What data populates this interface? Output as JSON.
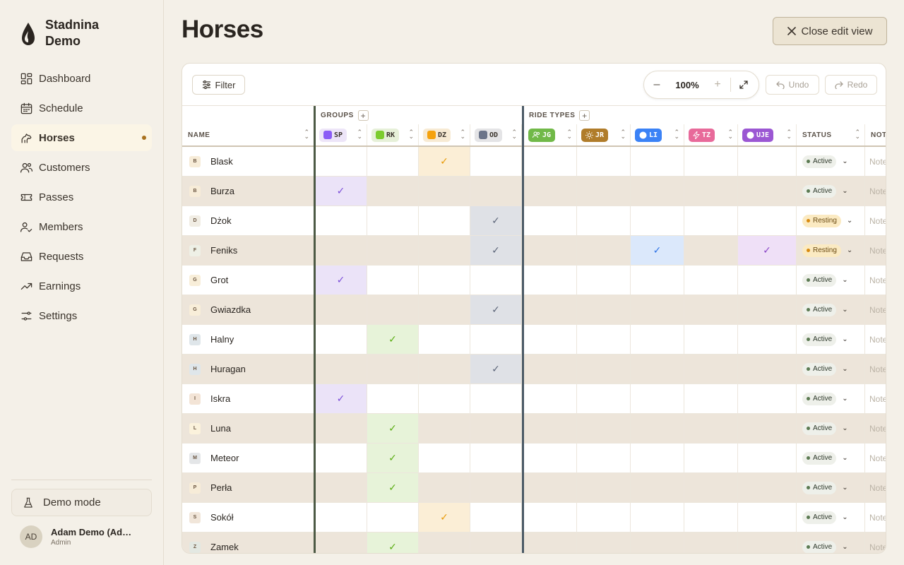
{
  "brand": {
    "line1": "Stadnina",
    "line2": "Demo"
  },
  "nav": [
    {
      "label": "Dashboard",
      "icon": "dashboard-icon"
    },
    {
      "label": "Schedule",
      "icon": "calendar-icon"
    },
    {
      "label": "Horses",
      "icon": "horse-icon",
      "active": true
    },
    {
      "label": "Customers",
      "icon": "users-icon"
    },
    {
      "label": "Passes",
      "icon": "ticket-icon"
    },
    {
      "label": "Members",
      "icon": "user-check-icon"
    },
    {
      "label": "Requests",
      "icon": "inbox-icon"
    },
    {
      "label": "Earnings",
      "icon": "trending-up-icon"
    },
    {
      "label": "Settings",
      "icon": "sliders-icon"
    }
  ],
  "demo_mode": "Demo mode",
  "user": {
    "initials": "AD",
    "name": "Adam Demo (Admin)",
    "role": "Admin"
  },
  "page_title": "Horses",
  "close_edit": "Close edit view",
  "toolbar": {
    "filter": "Filter",
    "zoom": "100%",
    "undo": "Undo",
    "redo": "Redo",
    "zoom_minus": "–",
    "zoom_plus": "+"
  },
  "table": {
    "name_header": "NAME",
    "groups_label": "GROUPS",
    "ride_types_label": "RIDE TYPES",
    "status_header": "STATUS",
    "notes_header": "NOTES",
    "notes_placeholder": "Notes",
    "plus": "+",
    "groups": [
      {
        "code": "SP",
        "color": "#8b5cf6",
        "bg": "#ede5f8",
        "check": "#7c4fd9",
        "cell": "#ebe3f8"
      },
      {
        "code": "RK",
        "color": "#7ccc2e",
        "bg": "#e6f0d8",
        "check": "#5aad12",
        "cell": "#e7f3d9"
      },
      {
        "code": "DZ",
        "color": "#f5a20d",
        "bg": "#f7ead3",
        "check": "#e89a08",
        "cell": "#fbeed6"
      },
      {
        "code": "OD",
        "color": "#6b7489",
        "bg": "#e4e4e6",
        "check": "#5c6579",
        "cell": "#dfe1e6"
      }
    ],
    "ride_types": [
      {
        "code": "JG",
        "color": "#71b948",
        "fg": "#ffffff",
        "icon": "group-icon",
        "cell": "#e5f2da"
      },
      {
        "code": "JR",
        "color": "#b07c2a",
        "fg": "#ffffff",
        "icon": "sun-icon",
        "cell": "#f5ead6"
      },
      {
        "code": "LI",
        "color": "#3b82f6",
        "fg": "#ffffff",
        "icon": "circle-icon",
        "check": "#2f74e8",
        "cell": "#dbe8fb"
      },
      {
        "code": "TZ",
        "color": "#e86a9a",
        "fg": "#ffffff",
        "icon": "bolt-icon",
        "cell": "#f9e0ea"
      },
      {
        "code": "UJE",
        "color": "#9b57d3",
        "fg": "#ffffff",
        "icon": "circle-icon",
        "check": "#8b47c8",
        "cell": "#efe0f7"
      }
    ],
    "check_mark": "✓",
    "rows": [
      {
        "initial": "B",
        "name": "Blask",
        "initial_bg": "#f7ecd8",
        "groups": [
          0,
          0,
          1,
          0
        ],
        "rides": [
          0,
          0,
          0,
          0,
          0
        ],
        "status": "Active"
      },
      {
        "initial": "B",
        "name": "Burza",
        "initial_bg": "#f7ecd8",
        "groups": [
          1,
          0,
          0,
          0
        ],
        "rides": [
          0,
          0,
          0,
          0,
          0
        ],
        "status": "Active"
      },
      {
        "initial": "D",
        "name": "Dżok",
        "initial_bg": "#f1ede4",
        "groups": [
          0,
          0,
          0,
          1
        ],
        "rides": [
          0,
          0,
          0,
          0,
          0
        ],
        "status": "Resting"
      },
      {
        "initial": "F",
        "name": "Feniks",
        "initial_bg": "#eef0e6",
        "groups": [
          0,
          0,
          0,
          1
        ],
        "rides": [
          0,
          0,
          1,
          0,
          1
        ],
        "status": "Resting"
      },
      {
        "initial": "G",
        "name": "Grot",
        "initial_bg": "#f8eed9",
        "groups": [
          1,
          0,
          0,
          0
        ],
        "rides": [
          0,
          0,
          0,
          0,
          0
        ],
        "status": "Active"
      },
      {
        "initial": "G",
        "name": "Gwiazdka",
        "initial_bg": "#f8eed9",
        "groups": [
          0,
          0,
          0,
          1
        ],
        "rides": [
          0,
          0,
          0,
          0,
          0
        ],
        "status": "Active"
      },
      {
        "initial": "H",
        "name": "Halny",
        "initial_bg": "#dfe6ea",
        "groups": [
          0,
          1,
          0,
          0
        ],
        "rides": [
          0,
          0,
          0,
          0,
          0
        ],
        "status": "Active"
      },
      {
        "initial": "H",
        "name": "Huragan",
        "initial_bg": "#dfe6ea",
        "groups": [
          0,
          0,
          0,
          1
        ],
        "rides": [
          0,
          0,
          0,
          0,
          0
        ],
        "status": "Active"
      },
      {
        "initial": "I",
        "name": "Iskra",
        "initial_bg": "#f3e4d6",
        "groups": [
          1,
          0,
          0,
          0
        ],
        "rides": [
          0,
          0,
          0,
          0,
          0
        ],
        "status": "Active"
      },
      {
        "initial": "L",
        "name": "Luna",
        "initial_bg": "#fbf2dc",
        "groups": [
          0,
          1,
          0,
          0
        ],
        "rides": [
          0,
          0,
          0,
          0,
          0
        ],
        "status": "Active"
      },
      {
        "initial": "M",
        "name": "Meteor",
        "initial_bg": "#e4e6e8",
        "groups": [
          0,
          1,
          0,
          0
        ],
        "rides": [
          0,
          0,
          0,
          0,
          0
        ],
        "status": "Active"
      },
      {
        "initial": "P",
        "name": "Perła",
        "initial_bg": "#f7ecd8",
        "groups": [
          0,
          1,
          0,
          0
        ],
        "rides": [
          0,
          0,
          0,
          0,
          0
        ],
        "status": "Active"
      },
      {
        "initial": "S",
        "name": "Sokół",
        "initial_bg": "#f1e6da",
        "groups": [
          0,
          0,
          1,
          0
        ],
        "rides": [
          0,
          0,
          0,
          0,
          0
        ],
        "status": "Active"
      },
      {
        "initial": "Z",
        "name": "Zamek",
        "initial_bg": "#e3e8e2",
        "groups": [
          0,
          1,
          0,
          0
        ],
        "rides": [
          0,
          0,
          0,
          0,
          0
        ],
        "status": "Active"
      }
    ],
    "status_styles": {
      "Active": {
        "bg": "#eef0ea",
        "dot": "#5b7a52",
        "fg": "#2f3a2c"
      },
      "Resting": {
        "bg": "#fbeac2",
        "dot": "#d88b10",
        "fg": "#6a4a12"
      }
    }
  }
}
